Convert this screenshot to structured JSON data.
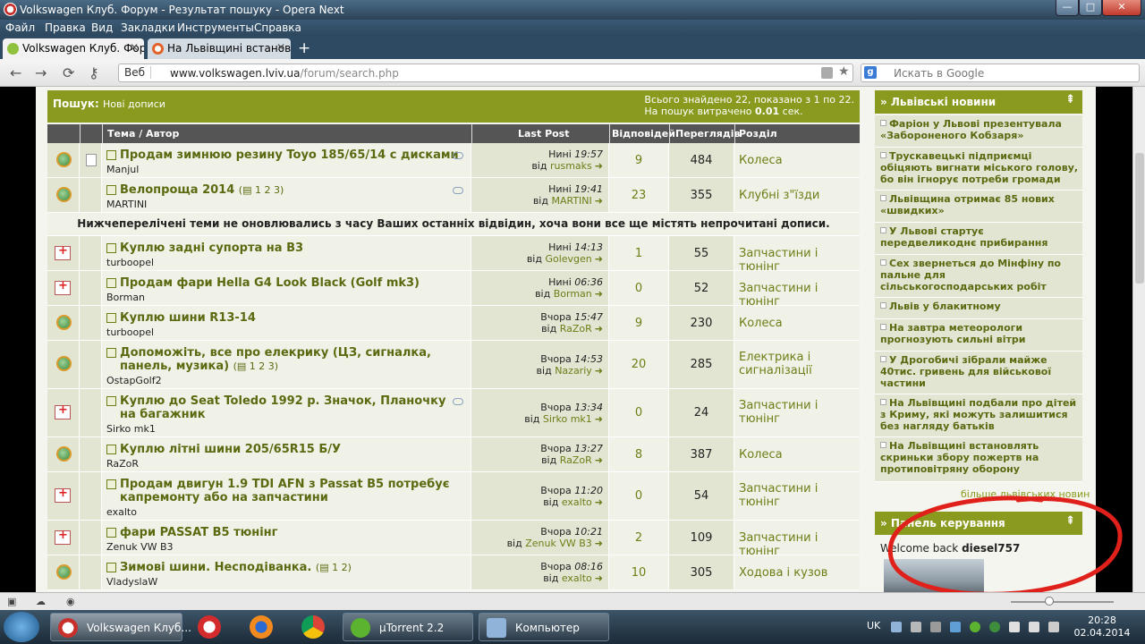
{
  "window": {
    "title": "Volkswagen Клуб. Форум - Результат пошуку - Opera Next",
    "min_glyph": "—",
    "max_glyph": "□",
    "close_glyph": "✕"
  },
  "menu": [
    "Файл",
    "Правка",
    "Вид",
    "Закладки",
    "Инструменты",
    "Справка"
  ],
  "tabs": [
    {
      "label": "Volkswagen Клуб. Фору...",
      "close": "✕",
      "active": true
    },
    {
      "label": "На Львівщині встанов...",
      "close": "✕",
      "active": false
    }
  ],
  "new_tab": "+",
  "nav": {
    "back": "←",
    "forward": "→",
    "reload": "⟳",
    "key": "⚷"
  },
  "address": {
    "web_label": "Веб",
    "host": "www.volkswagen.lviv.ua",
    "path": "/forum/search.php",
    "star": "★"
  },
  "search_box": {
    "engine": "g",
    "placeholder": "Искать в Google"
  },
  "forum": {
    "search_label": "Пошук:",
    "search_sub": "Нові дописи",
    "found_text": "Всього знайдено 22, показано з 1 по 22.",
    "time_prefix": "На пошук витрачено",
    "time_value": "0.01",
    "time_suffix": "сек.",
    "columns": [
      "Тема / Автор",
      "Last Post",
      "Відповідей",
      "Переглядів",
      "Розділ"
    ],
    "unread_note": "Нижчеперелічені теми не оновлювались з часу Ваших останніх відвідин, хоча вони все ще містять непрочитані дописи.",
    "by": "від",
    "rows": [
      {
        "title": "Продам зимнюю резину Toyo 185/65/14 с дисками",
        "pages": "",
        "author": "Manjul",
        "day": "Нині",
        "time": "19:57",
        "poster": "rusmaks",
        "replies": "9",
        "views": "484",
        "section": "Колеса",
        "icon": "medal"
      },
      {
        "title": "Велопроща 2014",
        "pages": "1 2 3",
        "author": "MARTINI",
        "day": "Нині",
        "time": "19:41",
        "poster": "MARTINI",
        "replies": "23",
        "views": "355",
        "section": "Клубні з\"їзди",
        "icon": "medal"
      },
      {
        "title": "Куплю задні супорта на B3",
        "pages": "",
        "author": "turboopel",
        "day": "Нині",
        "time": "14:13",
        "poster": "Golevgen",
        "replies": "1",
        "views": "55",
        "section": "Запчастини і тюнінг",
        "icon": "new"
      },
      {
        "title": "Продам фари Hella G4 Look Black (Golf mk3)",
        "pages": "",
        "author": "Borman",
        "day": "Нині",
        "time": "06:36",
        "poster": "Borman",
        "replies": "0",
        "views": "52",
        "section": "Запчастини і тюнінг",
        "icon": "new"
      },
      {
        "title": "Куплю шини R13-14",
        "pages": "",
        "author": "turboopel",
        "day": "Вчора",
        "time": "15:47",
        "poster": "RaZoR",
        "replies": "9",
        "views": "230",
        "section": "Колеса",
        "icon": "medal"
      },
      {
        "title": "Допоможіть, все про елекрику (ЦЗ, сигналка, панель, музика)",
        "pages": "1 2 3",
        "author": "OstapGolf2",
        "day": "Вчора",
        "time": "14:53",
        "poster": "Nazariy",
        "replies": "20",
        "views": "285",
        "section": "Електрика і сигналізації",
        "icon": "medal"
      },
      {
        "title": "Куплю до Seat Toledo 1992 р. Значок, Планочку на багажник",
        "pages": "",
        "author": "Sirko mk1",
        "day": "Вчора",
        "time": "13:34",
        "poster": "Sirko mk1",
        "replies": "0",
        "views": "24",
        "section": "Запчастини і тюнінг",
        "icon": "new"
      },
      {
        "title": "Куплю літні шини 205/65R15 Б/У",
        "pages": "",
        "author": "RaZoR",
        "day": "Вчора",
        "time": "13:27",
        "poster": "RaZoR",
        "replies": "8",
        "views": "387",
        "section": "Колеса",
        "icon": "medal"
      },
      {
        "title": "Продам двигун 1.9 TDI AFN з Passat B5 потребує капремонту або на запчастини",
        "pages": "",
        "author": "exalto",
        "day": "Вчора",
        "time": "11:20",
        "poster": "exalto",
        "replies": "0",
        "views": "54",
        "section": "Запчастини і тюнінг",
        "icon": "new"
      },
      {
        "title": "фари PASSAT B5 тюнінг",
        "pages": "",
        "author": "Zenuk VW B3",
        "day": "Вчора",
        "time": "10:21",
        "poster": "Zenuk VW B3",
        "replies": "2",
        "views": "109",
        "section": "Запчастини і тюнінг",
        "icon": "new"
      },
      {
        "title": "Зимові шини. Несподіванка.",
        "pages": "1 2",
        "author": "VladyslaW",
        "day": "Вчора",
        "time": "08:16",
        "poster": "exalto",
        "replies": "10",
        "views": "305",
        "section": "Ходова і кузов",
        "icon": "medal"
      }
    ]
  },
  "sidebar": {
    "news_title": "» Львівські новини",
    "toggle": "⇞",
    "news": [
      "Фаріон у Львові презентувала «Забороненого Кобзаря»",
      "Трускавецькі підприємці обіцяють вигнати міського голову, бо він ігнорує потреби громади",
      "Львівщина отримає 85 нових «швидких»",
      "У Львові стартує передвеликоднє прибирання",
      "Сех звернеться до Мінфіну по пальне для сільськогосподарських робіт",
      "Львів у блакитному",
      "На завтра метеорологи прогнозують сильні вітри",
      "У Дрогобичі зібрали майже 40тис. гривень для військової частини",
      "На Львівщині подбали про дітей з Криму, які можуть залишитися без нагляду батьків",
      "На Львівщині встановлять скриньки збору пожертв на протиповітряну оборону"
    ],
    "more_news": "більше львівських новин",
    "panel_title": "» Панель керування",
    "welcome": "Welcome back",
    "username": "diesel757"
  },
  "taskbar": {
    "items": [
      "Volkswagen Клуб...",
      "µTorrent 2.2",
      "Компьютер"
    ],
    "lang": "UK",
    "time": "20:28",
    "date": "02.04.2014"
  },
  "colors": {
    "accent": "#8a9a1e",
    "link": "#6e7d17",
    "annotation": "#e0201a"
  }
}
